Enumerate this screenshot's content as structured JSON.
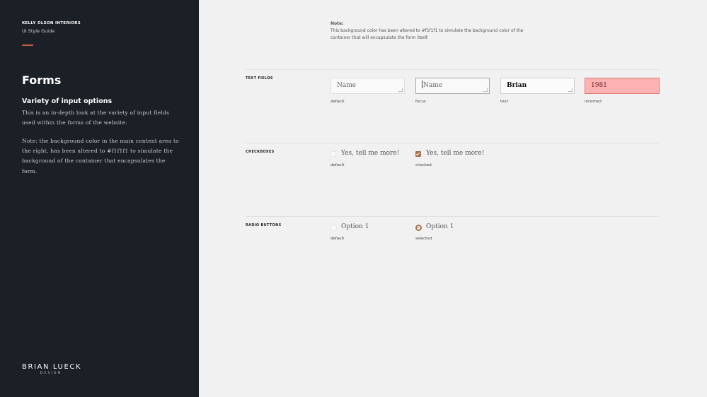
{
  "sidebar": {
    "brand": "KELLY OLSON INTERIORS",
    "subbrand": "UI Style Guide",
    "title": "Forms",
    "subtitle": "Variety of input options",
    "paragraph1": "This is an in-depth look at the variety of input fields used within the forms of the website.",
    "paragraph2": "Note: the background color in the main content area to the right, has been altered to #f1f1f1 to simulate the background of the container that encapsulates the form.",
    "logo_main": "BRIAN LUECK",
    "logo_sub": "DESIGN"
  },
  "note": {
    "title": "Note:",
    "text": "This background color has been altered to #f1f1f1 to simulate the background color of the container that will encapsulate the form itself."
  },
  "sections": {
    "text_fields": {
      "label": "TEXT FIELDS",
      "fields": [
        {
          "value": "Name",
          "state": "default"
        },
        {
          "value": "Name",
          "state": "focus"
        },
        {
          "value": "Brian",
          "state": "text"
        },
        {
          "value": "1981",
          "state": "incorrect"
        }
      ]
    },
    "checkboxes": {
      "label": "CHECKBOXES",
      "items": [
        {
          "label": "Yes, tell me more!",
          "state": "default",
          "checked": false
        },
        {
          "label": "Yes, tell me more!",
          "state": "checked",
          "checked": true
        }
      ]
    },
    "radio_buttons": {
      "label": "RADIO BUTTONS",
      "items": [
        {
          "label": "Option 1",
          "state": "default",
          "selected": false
        },
        {
          "label": "Option 1",
          "state": "selected",
          "selected": true
        }
      ]
    }
  },
  "colors": {
    "sidebar_bg": "#1b1f26",
    "content_bg": "#f1f1f1",
    "accent": "#c8584a",
    "checked": "#a5714c",
    "error_bg": "#ffb2b2"
  }
}
